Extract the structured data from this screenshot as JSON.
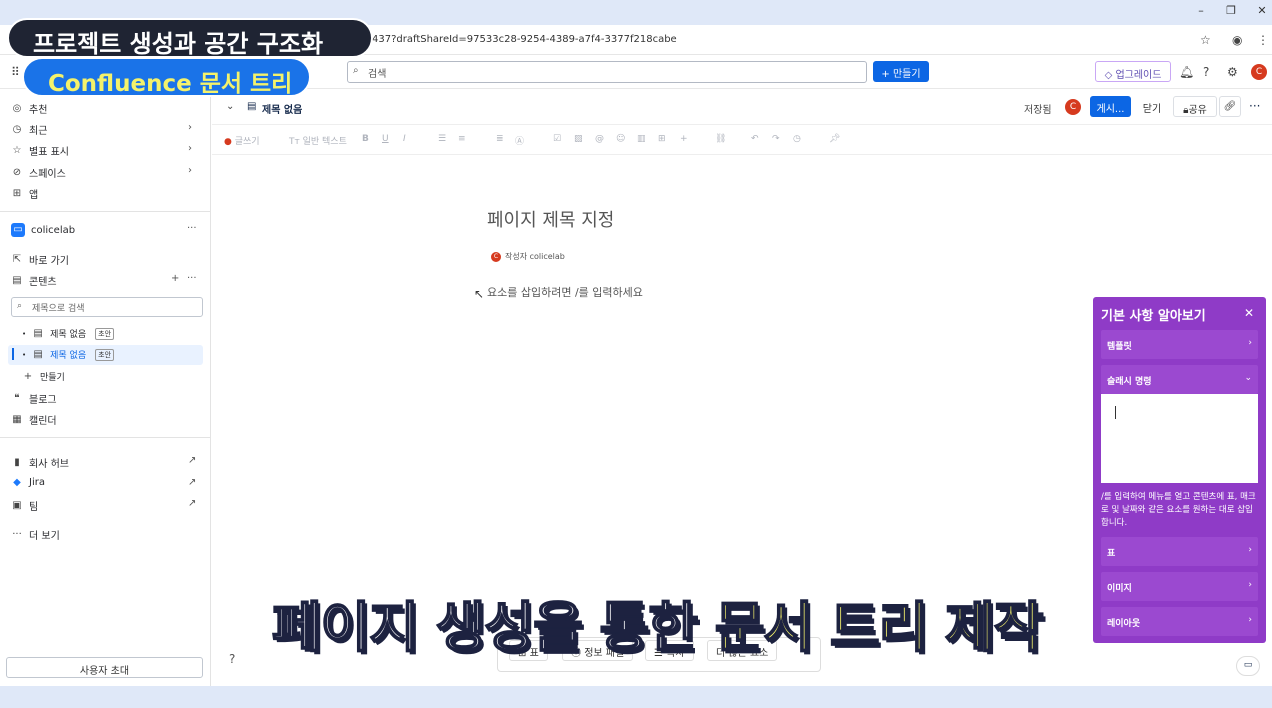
{
  "browser": {
    "url": "437?draftShareId=97533c28-9254-4389-a7f4-3377f218cabe",
    "window_controls": [
      "–",
      "❐",
      "✕"
    ]
  },
  "topbar": {
    "search_placeholder": "검색",
    "create_label": "+ 만들기",
    "upgrade_label": "업그레이드",
    "user_initial": "C"
  },
  "sidebar": {
    "nav": [
      {
        "label": "추천"
      },
      {
        "label": "최근"
      },
      {
        "label": "별표 표시"
      },
      {
        "label": "스페이스"
      },
      {
        "label": "앱"
      }
    ],
    "space_name": "colicelab",
    "shortcut_label": "바로 가기",
    "content_label": "콘텐츠",
    "search_placeholder": "제목으로 검색",
    "tree": [
      {
        "label": "제목 없음",
        "badge": "초안"
      },
      {
        "label": "제목 없음",
        "badge": "초안"
      }
    ],
    "create_label": "만들기",
    "blog_label": "블로그",
    "calendar_label": "캘린더",
    "links": [
      {
        "label": "회사 허브"
      },
      {
        "label": "Jira"
      },
      {
        "label": "팀"
      }
    ],
    "more_label": "더 보기",
    "invite_label": "사용자 초대"
  },
  "page_header": {
    "title": "제목 없음",
    "saved_label": "저장됨",
    "publish_label": "게시...",
    "close_label": "닫기",
    "share_label": "공유"
  },
  "toolbar": {
    "write_label": "글쓰기",
    "text_style_label": "Tт 일반 텍스트"
  },
  "editor": {
    "title_placeholder": "페이지 제목 지정",
    "author_label": "작성자 colicelab",
    "body_placeholder": "요소를 삽입하려면 /를 입력하세요"
  },
  "help_panel": {
    "title": "기본 사항 알아보기",
    "items_top": [
      {
        "label": "템플릿"
      },
      {
        "label": "슬래시 명령"
      }
    ],
    "description": "/를 입력하여 메뉴를 열고 콘텐츠에 표, 매크로 및 날짜와 같은 요소를 원하는 대로 삽입합니다.",
    "items_bottom": [
      {
        "label": "표"
      },
      {
        "label": "이미지"
      },
      {
        "label": "레이아웃"
      }
    ]
  },
  "bottom_bar": {
    "buttons": [
      {
        "label": "표"
      },
      {
        "label": "정보 패널"
      },
      {
        "label": "목차"
      },
      {
        "label": "더 많은 요소"
      }
    ]
  },
  "overlays": {
    "title_caption": "프로젝트 생성과 공간 구조화",
    "sub_caption": "Confluence 문서 트리",
    "big_caption_white": "페이지 생성을 통한 ",
    "big_caption_yellow": "문서 트리 제작"
  },
  "colors": {
    "accent": "#0c66e4",
    "panel": "#8f3bc7",
    "avatar": "#d63a1f",
    "caption_yellow": "#f4f26b"
  }
}
